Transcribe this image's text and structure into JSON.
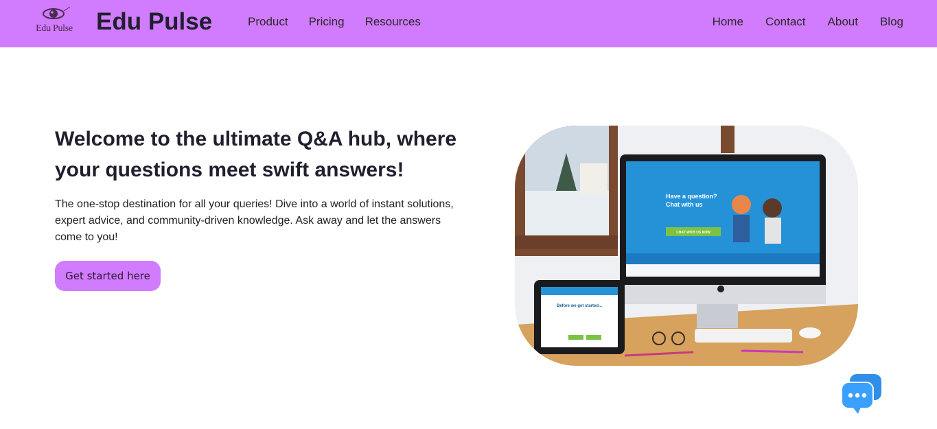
{
  "header": {
    "logo_text": "Edu Pulse",
    "brand": "Edu Pulse",
    "nav_left": [
      "Product",
      "Pricing",
      "Resources"
    ],
    "nav_right": [
      "Home",
      "Contact",
      "About",
      "Blog"
    ]
  },
  "hero": {
    "headline": "Welcome to the ultimate Q&A hub, where your questions meet swift answers!",
    "description": "The one-stop destination for all your queries! Dive into a world of instant solutions, expert advice, and community-driven knowledge. Ask away and let the answers come to you!",
    "cta_label": "Get started here"
  },
  "mockup": {
    "monitor_heading_1": "Have a question?",
    "monitor_heading_2": "Chat with us",
    "monitor_button": "CHAT WITH US NOW",
    "tablet_heading": "Before we get started..."
  },
  "colors": {
    "accent": "#d17bff",
    "chat_bubble": "#2f8fe8"
  },
  "icons": {
    "logo": "eye-logo-icon",
    "chat": "chat-bubble-icon"
  }
}
